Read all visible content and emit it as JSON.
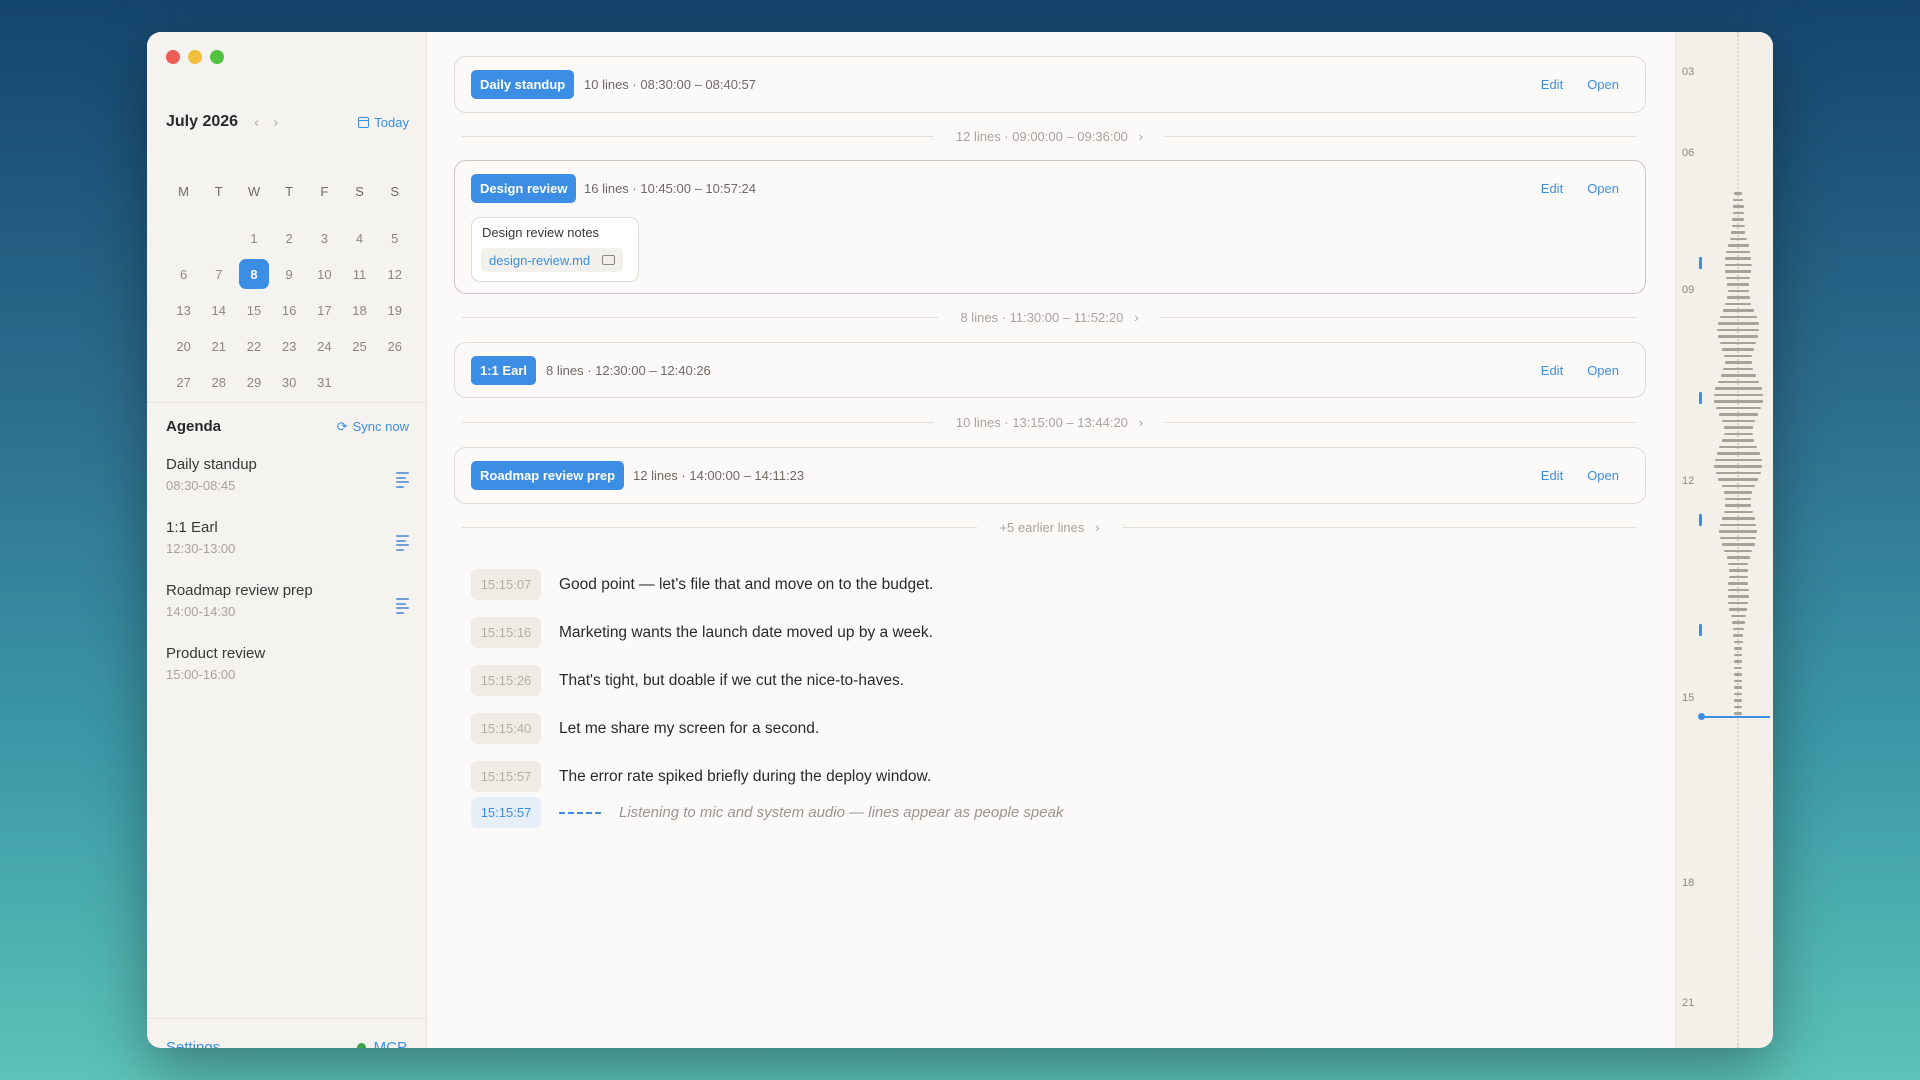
{
  "calendar": {
    "month_label": "July 2026",
    "today_label": "Today",
    "weekdays": [
      "M",
      "T",
      "W",
      "T",
      "F",
      "S",
      "S"
    ],
    "selected_day": "8",
    "weeks": [
      [
        "",
        "",
        "1",
        "2",
        "3",
        "4",
        "5"
      ],
      [
        "6",
        "7",
        "8",
        "9",
        "10",
        "11",
        "12"
      ],
      [
        "13",
        "14",
        "15",
        "16",
        "17",
        "18",
        "19"
      ],
      [
        "20",
        "21",
        "22",
        "23",
        "24",
        "25",
        "26"
      ],
      [
        "27",
        "28",
        "29",
        "30",
        "31",
        "",
        ""
      ]
    ]
  },
  "agenda": {
    "title": "Agenda",
    "sync_label": "Sync now",
    "items": [
      {
        "name": "Daily standup",
        "time": "08:30-08:45",
        "has_notes": true
      },
      {
        "name": "1:1 Earl",
        "time": "12:30-13:00",
        "has_notes": true
      },
      {
        "name": "Roadmap review prep",
        "time": "14:00-14:30",
        "has_notes": true
      },
      {
        "name": "Product review",
        "time": "15:00-16:00",
        "has_notes": false
      }
    ]
  },
  "footer": {
    "settings_label": "Settings",
    "mcp_label": "MCP",
    "mcp_status_color": "#3aa447"
  },
  "meetings": [
    {
      "tag": "Daily standup",
      "meta": "10 lines · 08:30:00 – 08:40:57",
      "edit": "Edit",
      "open": "Open"
    },
    {
      "tag": "Design review",
      "meta": "16 lines · 10:45:00 – 10:57:24",
      "edit": "Edit",
      "open": "Open",
      "note_title": "Design review notes",
      "note_file": "design-review.md"
    },
    {
      "tag": "1:1 Earl",
      "meta": "8 lines · 12:30:00 – 12:40:26",
      "edit": "Edit",
      "open": "Open"
    },
    {
      "tag": "Roadmap review prep",
      "meta": "12 lines · 14:00:00 – 14:11:23",
      "edit": "Edit",
      "open": "Open"
    }
  ],
  "gaps": [
    "12 lines · 09:00:00 – 09:36:00",
    "8 lines · 11:30:00 – 11:52:20",
    "10 lines · 13:15:00 – 13:44:20",
    "+5 earlier lines"
  ],
  "transcript": [
    {
      "time": "15:15:07",
      "text": "Good point — let's file that and move on to the budget."
    },
    {
      "time": "15:15:16",
      "text": "Marketing wants the launch date moved up by a week."
    },
    {
      "time": "15:15:26",
      "text": "That's tight, but doable if we cut the nice-to-haves."
    },
    {
      "time": "15:15:40",
      "text": "Let me share my screen for a second."
    },
    {
      "time": "15:15:57",
      "text": "The error rate spiked briefly during the deploy window."
    }
  ],
  "live": {
    "time": "15:15:57",
    "text": "Listening to mic and system audio — lines appear as people speak"
  },
  "timeline": {
    "hours": [
      "03",
      "06",
      "09",
      "12",
      "15",
      "18",
      "21"
    ]
  },
  "colors": {
    "accent": "#3b8ee3",
    "live_dot": "#3aa447"
  }
}
